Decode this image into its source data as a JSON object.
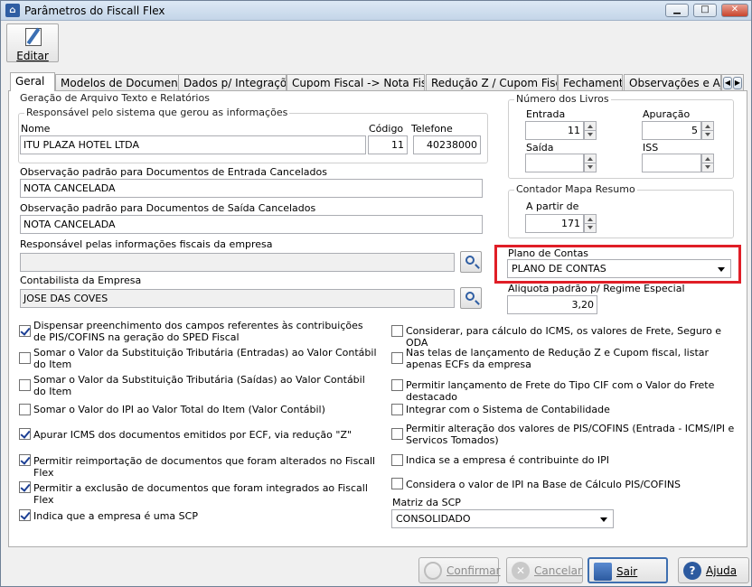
{
  "window": {
    "title": "Parâmetros do Fiscall Flex",
    "icon": "app-icon"
  },
  "toolbar": {
    "edit_label": "Editar"
  },
  "tabs": [
    "Geral",
    "Modelos de Documento",
    "Dados p/ Integrações",
    "Cupom Fiscal -> Nota Fiscal",
    "Redução Z / Cupom Fiscal",
    "Fechamento",
    "Observações e Ajus"
  ],
  "geracao": {
    "title": "Geração de Arquivo Texto e Relatórios",
    "resp_group": "Responsável pelo sistema que gerou as informações",
    "nome_label": "Nome",
    "nome_value": "ITU PLAZA HOTEL LTDA",
    "codigo_label": "Código",
    "codigo_value": "11",
    "telefone_label": "Telefone",
    "telefone_value": "40238000",
    "obs_entrada_label": "Observação padrão para Documentos de Entrada Cancelados",
    "obs_entrada_value": "NOTA CANCELADA",
    "obs_saida_label": "Observação padrão para Documentos de Saída Cancelados",
    "obs_saida_value": "NOTA CANCELADA",
    "resp_fiscais_label": "Responsável pelas informações fiscais da empresa",
    "resp_fiscais_value": "",
    "contabilista_label": "Contabilista da Empresa",
    "contabilista_value": "JOSE DAS COVES"
  },
  "livros": {
    "title": "Número dos Livros",
    "entrada_label": "Entrada",
    "entrada_value": "11",
    "apuracao_label": "Apuração",
    "apuracao_value": "5",
    "saida_label": "Saída",
    "saida_value": "",
    "iss_label": "ISS",
    "iss_value": ""
  },
  "contador": {
    "title": "Contador Mapa Resumo",
    "label": "A partir de",
    "value": "171"
  },
  "plano": {
    "label": "Plano de Contas",
    "value": "PLANO DE CONTAS"
  },
  "aliquota": {
    "label": "Aliquota padrão p/ Regime Especial",
    "value": "3,20"
  },
  "checks_left": [
    {
      "label": "Dispensar preenchimento dos campos referentes às contribuições de PIS/COFINS na geração do SPED Fiscal",
      "checked": true
    },
    {
      "label": "Somar o Valor da Substituição Tributária (Entradas) ao Valor Contábil do Item",
      "checked": false
    },
    {
      "label": "Somar o Valor da Substituição Tributária (Saídas) ao Valor Contábil do Item",
      "checked": false
    },
    {
      "label": "Somar o Valor do IPI ao Valor Total do Item (Valor Contábil)",
      "checked": false
    },
    {
      "label": "Apurar ICMS dos documentos emitidos por ECF, via redução \"Z\"",
      "checked": true
    },
    {
      "label": "Permitir reimportação de documentos que foram alterados no Fiscall Flex",
      "checked": true
    },
    {
      "label": "Permitir a exclusão de documentos que foram integrados ao Fiscall Flex",
      "checked": true
    },
    {
      "label": "Indica que a empresa é uma SCP",
      "checked": true
    }
  ],
  "checks_right": [
    {
      "label": "Considerar, para cálculo do ICMS, os valores de Frete, Seguro e ODA",
      "checked": false
    },
    {
      "label": "Nas telas de lançamento de Redução Z e Cupom fiscal, listar apenas ECFs da empresa",
      "checked": false
    },
    {
      "label": "Permitir lançamento de Frete do Tipo CIF com o Valor do Frete destacado",
      "checked": false
    },
    {
      "label": "Integrar com o Sistema de Contabilidade",
      "checked": false
    },
    {
      "label": "Permitir alteração dos valores de PIS/COFINS (Entrada - ICMS/IPI e Servicos Tomados)",
      "checked": false
    },
    {
      "label": "Indica se a empresa é contribuinte do IPI",
      "checked": false
    },
    {
      "label": "Considera o valor de IPI na Base de Cálculo PIS/COFINS",
      "checked": false
    }
  ],
  "matriz": {
    "label": "Matriz da SCP",
    "value": "CONSOLIDADO"
  },
  "buttons": {
    "confirmar": "Confirmar",
    "cancelar": "Cancelar",
    "sair": "Sair",
    "ajuda": "Ajuda"
  },
  "colors": {
    "highlight": "#e01e27",
    "accent": "#2f5ea3"
  }
}
